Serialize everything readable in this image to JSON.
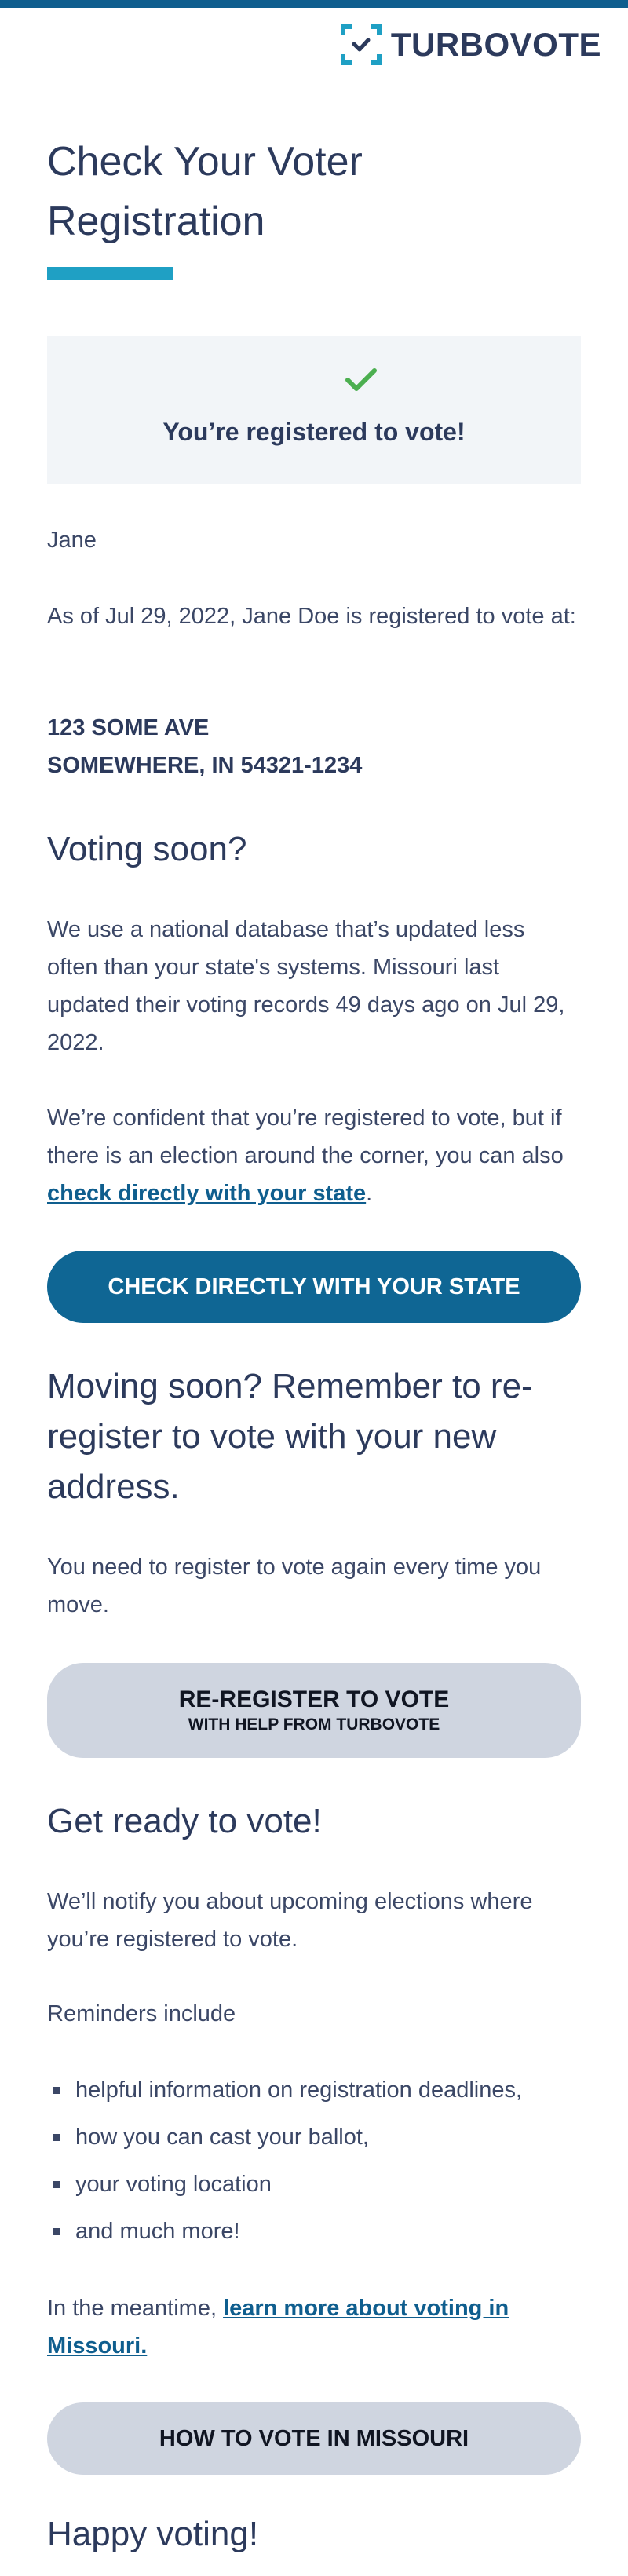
{
  "brand": {
    "name": "TURBOVOTE"
  },
  "colors": {
    "accent": "#1fa0c4",
    "primary": "#0f6694",
    "text": "#2c3a5c",
    "success": "#4caf50"
  },
  "page_title": "Check Your Voter Registration",
  "status": {
    "icon": "checkmark-icon",
    "text": "You’re registered to vote!"
  },
  "greeting": "Jane",
  "registration": {
    "text": "As of Jul 29, 2022, Jane Doe is registered to vote at:",
    "address_line1": "123 SOME AVE",
    "address_line2": "SOMEWHERE, IN 54321-1234"
  },
  "voting_soon": {
    "heading": "Voting soon?",
    "para1": "We use a national database that’s updated less often than your state's systems. Missouri last updated their voting records 49 days ago on Jul 29, 2022.",
    "para2_prefix": "We’re confident that you’re registered to vote, but if there is an election around the corner, you can also ",
    "para2_link": "check directly with your state",
    "para2_suffix": ".",
    "button": "CHECK DIRECTLY WITH YOUR STATE"
  },
  "moving": {
    "heading": "Moving soon? Remember to re-register to vote with your new address.",
    "para": "You need to register to vote again every time you move.",
    "button_line1": "RE-REGISTER TO VOTE",
    "button_line2": "WITH HELP FROM TURBOVOTE"
  },
  "get_ready": {
    "heading": "Get ready to vote!",
    "para": "We’ll notify you about upcoming elections where you’re registered to vote.",
    "reminders_label": "Reminders include",
    "reminders": [
      "helpful information on registration deadlines,",
      "how you can cast your ballot,",
      "your voting location",
      "and much more!"
    ],
    "meantime_prefix": "In the meantime, ",
    "meantime_link": "learn more about voting in Missouri.",
    "button": "HOW TO VOTE IN MISSOURI"
  },
  "closing": "Happy voting!"
}
